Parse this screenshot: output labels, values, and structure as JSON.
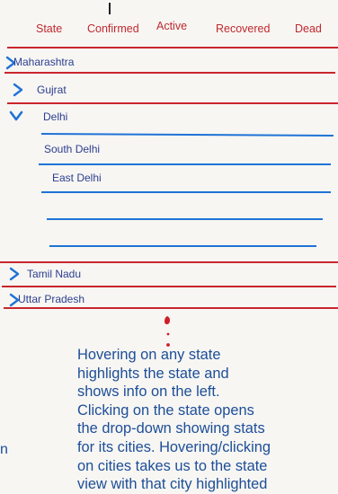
{
  "header": {
    "columns": [
      "State",
      "Confirmed",
      "Active",
      "Recovered",
      "Dead"
    ]
  },
  "states": [
    {
      "name": "Maharashtra",
      "expanded": false
    },
    {
      "name": "Gujrat",
      "expanded": false
    },
    {
      "name": "Delhi",
      "expanded": true
    },
    {
      "name": "Tamil Nadu",
      "expanded": false
    },
    {
      "name": "Uttar Pradesh",
      "expanded": false
    }
  ],
  "delhi_cities": [
    "South Delhi",
    "East Delhi"
  ],
  "annotation": {
    "text": "Hovering on any state\nhighlights the state and\nshows info on the left.\nClicking on the state opens\nthe drop-down showing stats\nfor its cities. Hovering/clicking\non cities takes us to the state\nview with that city highlighted",
    "stray": "n"
  },
  "colors": {
    "red": "#c9262c",
    "blue": "#1f73d6",
    "label": "#2c3e8f",
    "note": "#1d4e97",
    "background": "#f7f6f3"
  },
  "icons": {
    "collapsed": "chevron-right-icon",
    "expanded": "chevron-down-icon"
  }
}
